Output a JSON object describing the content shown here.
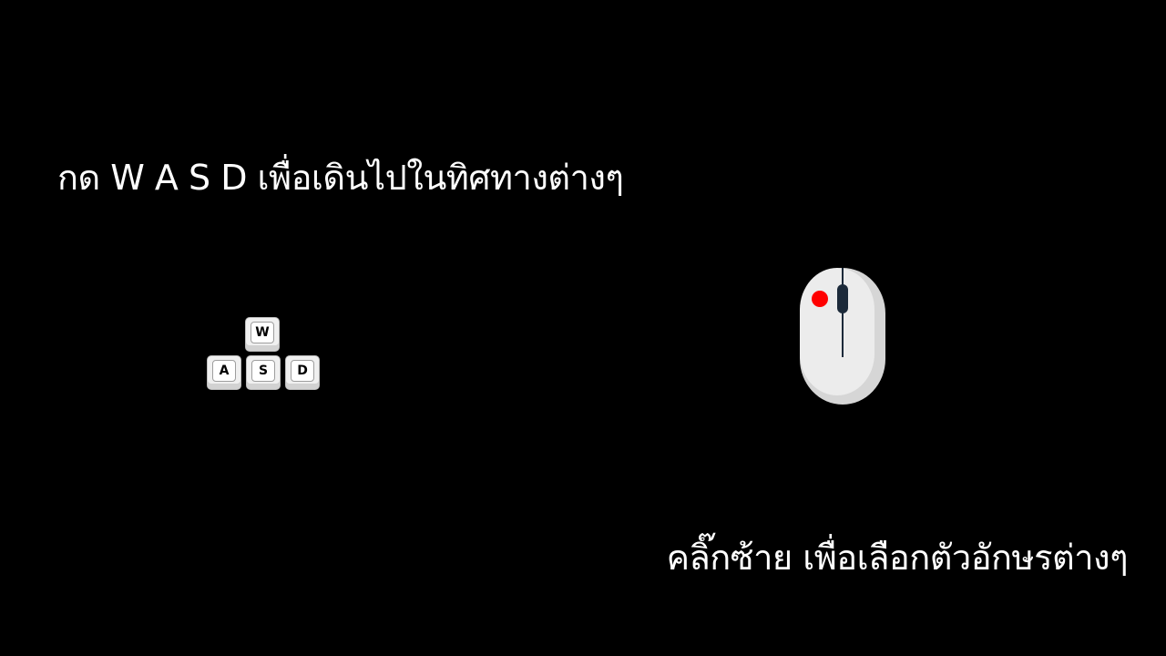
{
  "instructions": {
    "movement": "กด W A S D เพื่อเดินไปในทิศทางต่างๆ",
    "select": "คลิ๊กซ้าย เพื่อเลือกตัวอักษรต่างๆ"
  },
  "keys": {
    "w": "W",
    "a": "A",
    "s": "S",
    "d": "D"
  },
  "icons": {
    "keyboard": "wasd-keys-icon",
    "mouse": "mouse-left-click-icon"
  },
  "colors": {
    "background": "#000000",
    "text": "#ffffff",
    "click_indicator": "#ff0000",
    "mouse_body": "#ececec",
    "scroll_wheel": "#1c2a3a"
  }
}
